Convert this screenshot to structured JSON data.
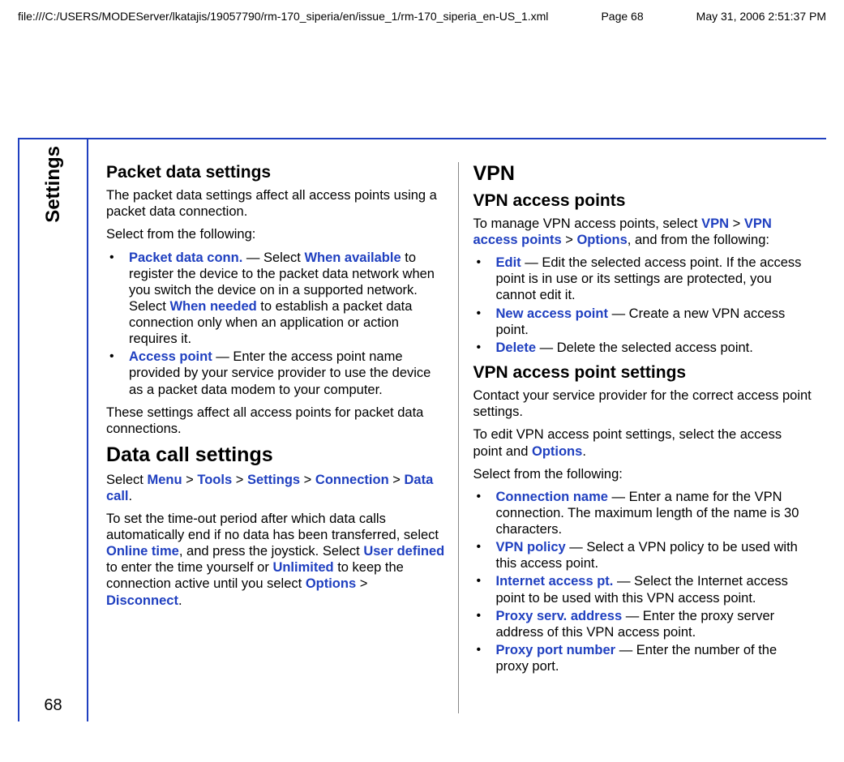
{
  "header": {
    "path": "file:///C:/USERS/MODEServer/lkatajis/19057790/rm-170_siperia/en/issue_1/rm-170_siperia_en-US_1.xml",
    "page_label": "Page 68",
    "timestamp": "May 31, 2006 2:51:37 PM"
  },
  "sidebar": {
    "tab_label": "Settings",
    "page_number": "68"
  },
  "col1": {
    "h2_packet": "Packet data settings",
    "p_packet_intro": "The packet data settings affect all access points using a packet data connection.",
    "p_select": "Select from the following:",
    "li_packet_conn": {
      "term": "Packet data conn.",
      "sep": " — Select ",
      "opt1": "When available",
      "txt1": " to register the device to the packet data network when you switch the device on in a supported network. Select ",
      "opt2": "When needed",
      "txt2": " to establish a packet data connection only when an application or action requires it."
    },
    "li_access_point": {
      "term": "Access point",
      "txt": " — Enter the access point name provided by your service provider to use the device as a packet data modem to your computer."
    },
    "p_packet_affect": "These settings affect all access points for packet data connections.",
    "h1_datacall": "Data call settings",
    "p_datacall_path": {
      "pre": "Select ",
      "m1": "Menu",
      "m2": "Tools",
      "m3": "Settings",
      "m4": "Connection",
      "m5": "Data call",
      "post": "."
    },
    "p_datacall_body": {
      "t1": "To set the time-out period after which data calls automatically end if no data has been transferred, select ",
      "k1": "Online time",
      "t2": ", and press the joystick. Select ",
      "k2": "User defined",
      "t3": " to enter the time yourself or ",
      "k3": "Unlimited",
      "t4": " to keep the connection active until you select ",
      "k4": "Options",
      "t5": " > ",
      "k5": "Disconnect",
      "t6": "."
    }
  },
  "col2": {
    "h1_vpn": "VPN",
    "h2_vpn_ap": "VPN access points",
    "p_vpn_manage": {
      "t1": "To manage VPN access points, select ",
      "k1": "VPN",
      "k2": "VPN access points",
      "k3": "Options",
      "t2": ", and from the following:"
    },
    "li_edit": {
      "term": "Edit",
      "txt": " — Edit the selected access point. If the access point is in use or its settings are protected, you cannot edit it."
    },
    "li_new": {
      "term": "New access point",
      "txt": " — Create a new VPN access point."
    },
    "li_delete": {
      "term": "Delete",
      "txt": " — Delete the selected access point."
    },
    "h2_vpn_aps": "VPN access point settings",
    "p_contact": "Contact your service provider for the correct access point settings.",
    "p_toedit": {
      "t1": "To edit VPN access point settings, select the access point and ",
      "k1": "Options",
      "t2": "."
    },
    "p_select2": "Select from the following:",
    "li_conn_name": {
      "term": "Connection name",
      "txt": " — Enter a name for the VPN connection. The maximum length of the name is 30 characters."
    },
    "li_vpn_policy": {
      "term": "VPN policy",
      "txt": " — Select a VPN policy to be used with this access point."
    },
    "li_iap": {
      "term": "Internet access pt.",
      "txt": " — Select the Internet access point to be used with this VPN access point."
    },
    "li_proxy_addr": {
      "term": "Proxy serv. address",
      "txt": " — Enter the proxy server address of this VPN access point."
    },
    "li_proxy_port": {
      "term": "Proxy port number",
      "txt": " — Enter the number of the proxy port."
    }
  }
}
